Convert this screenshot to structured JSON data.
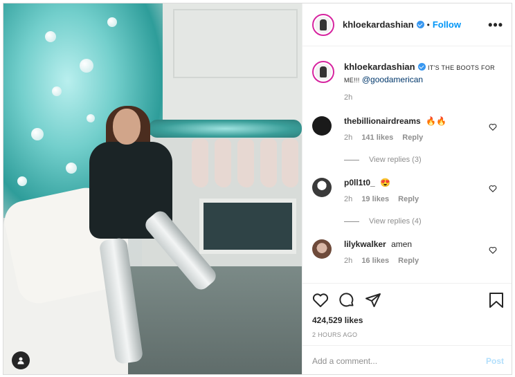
{
  "post": {
    "username": "khloekardashian",
    "separator": "•",
    "follow_label": "Follow",
    "more_label": "•••"
  },
  "caption": {
    "username": "khloekardashian",
    "text": "IT'S THE BOOTS FOR ME!!!",
    "mention": "@goodamerican",
    "time": "2h"
  },
  "comments": [
    {
      "username": "thebillionairdreams",
      "text": "🔥🔥",
      "time": "2h",
      "likes": "141 likes",
      "reply_label": "Reply",
      "view_replies": "View replies (3)",
      "avatar_color": "#1a1a1a"
    },
    {
      "username": "p0ll1t0_",
      "text": "😍",
      "time": "2h",
      "likes": "19 likes",
      "reply_label": "Reply",
      "view_replies": "View replies (4)",
      "avatar_color": "#3a3a3a"
    },
    {
      "username": "lilykwalker",
      "text": "amen",
      "time": "2h",
      "likes": "16 likes",
      "reply_label": "Reply",
      "avatar_color": "#b38b7a"
    }
  ],
  "stats": {
    "likes": "424,529 likes",
    "posted": "2 HOURS AGO"
  },
  "add_comment": {
    "placeholder": "Add a comment...",
    "post_label": "Post"
  },
  "colors": {
    "accent": "#0095f6",
    "verified": "#3897f0",
    "muted": "#8e8e8e"
  },
  "icons": [
    "verified-badge-icon",
    "more-options-icon",
    "heart-icon",
    "comment-icon",
    "share-icon",
    "bookmark-icon",
    "user-tag-icon"
  ]
}
